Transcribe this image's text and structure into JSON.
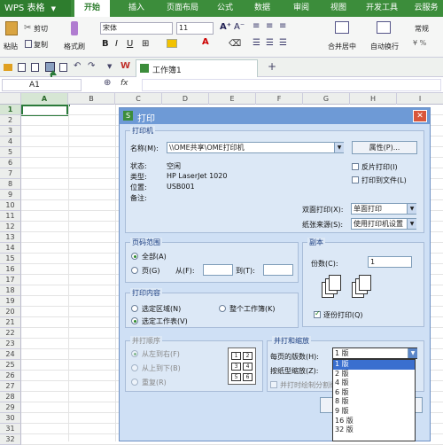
{
  "app": {
    "name": "WPS 表格"
  },
  "tabs": [
    "开始",
    "插入",
    "页面布局",
    "公式",
    "数据",
    "审阅",
    "视图",
    "开发工具",
    "云服务"
  ],
  "ribbon": {
    "paste": "粘贴",
    "cut": "剪切",
    "copy": "复制",
    "format_painter": "格式刷",
    "font": "宋体",
    "size": "11",
    "merge": "合并居中",
    "wrap": "自动换行",
    "style": "常规"
  },
  "doc_tab": "工作簿1",
  "formula_bar": {
    "cell_ref": "A1",
    "fx": "fx"
  },
  "columns": [
    "A",
    "B",
    "C",
    "D",
    "E",
    "F",
    "G",
    "H",
    "I"
  ],
  "rows": [
    "1",
    "2",
    "3",
    "4",
    "5",
    "6",
    "7",
    "8",
    "9",
    "10",
    "11",
    "12",
    "13",
    "14",
    "15",
    "16",
    "17",
    "18",
    "19",
    "20",
    "21",
    "22",
    "23",
    "24",
    "25",
    "26",
    "27",
    "28",
    "29",
    "30",
    "31",
    "32"
  ],
  "dialog": {
    "title": "打印",
    "printer": {
      "group": "打印机",
      "name_label": "名称(M):",
      "name_value": "\\\\OME共享\\OME打印机",
      "props_button": "属性(P)...",
      "status_label": "状态:",
      "status": "空闲",
      "type_label": "类型:",
      "type": "HP LaserJet 1020",
      "where_label": "位置:",
      "where": "USB001",
      "comment_label": "备注:",
      "reverse": "反片打印(I)",
      "to_file": "打印到文件(L)",
      "duplex_label": "双面打印(X):",
      "duplex_value": "单面打印",
      "source_label": "纸张来源(S):",
      "source_value": "使用打印机设置"
    },
    "range": {
      "group": "页码范围",
      "all": "全部(A)",
      "pages": "页(G)",
      "from": "从(F):",
      "to": "到(T):"
    },
    "copies": {
      "group": "副本",
      "label": "份数(C):",
      "value": "1",
      "collate": "逐份打印(Q)"
    },
    "content": {
      "group": "打印内容",
      "selection": "选定区域(N)",
      "workbook": "整个工作簿(K)",
      "sheets": "选定工作表(V)"
    },
    "order": {
      "group": "并打顺序",
      "ltr": "从左到右(F)",
      "ttb": "从上到下(B)",
      "repeat": "重复(R)"
    },
    "scale": {
      "group": "并打和缩放",
      "per_page_label": "每页的版数(H):",
      "per_page_value": "1 版",
      "paper_label": "按纸型缩放(Z):",
      "split_line": "并打时绘制分割线",
      "options": [
        "1 版",
        "2 版",
        "4 版",
        "6 版",
        "8 版",
        "9 版",
        "16 版",
        "32 版"
      ]
    }
  }
}
